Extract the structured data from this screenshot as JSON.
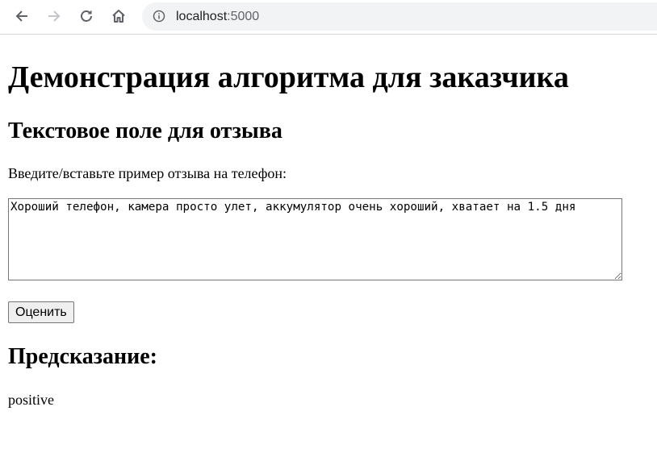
{
  "browser": {
    "url_host": "localhost",
    "url_port": ":5000",
    "icons": {
      "back": "arrow-left-icon",
      "forward": "arrow-right-icon",
      "reload": "reload-icon",
      "home": "home-icon",
      "site_info": "info-icon"
    }
  },
  "page": {
    "title": "Демонстрация алгоритма для заказчика",
    "section_heading": "Текстовое поле для отзыва",
    "prompt_label": "Введите/вставьте пример отзыва на телефон:",
    "review_text": "Хороший телефон, камера просто улет, аккумулятор очень хороший, хватает на 1.5 дня",
    "submit_label": "Оценить",
    "prediction_heading": "Предсказание:",
    "prediction_value": "positive"
  }
}
